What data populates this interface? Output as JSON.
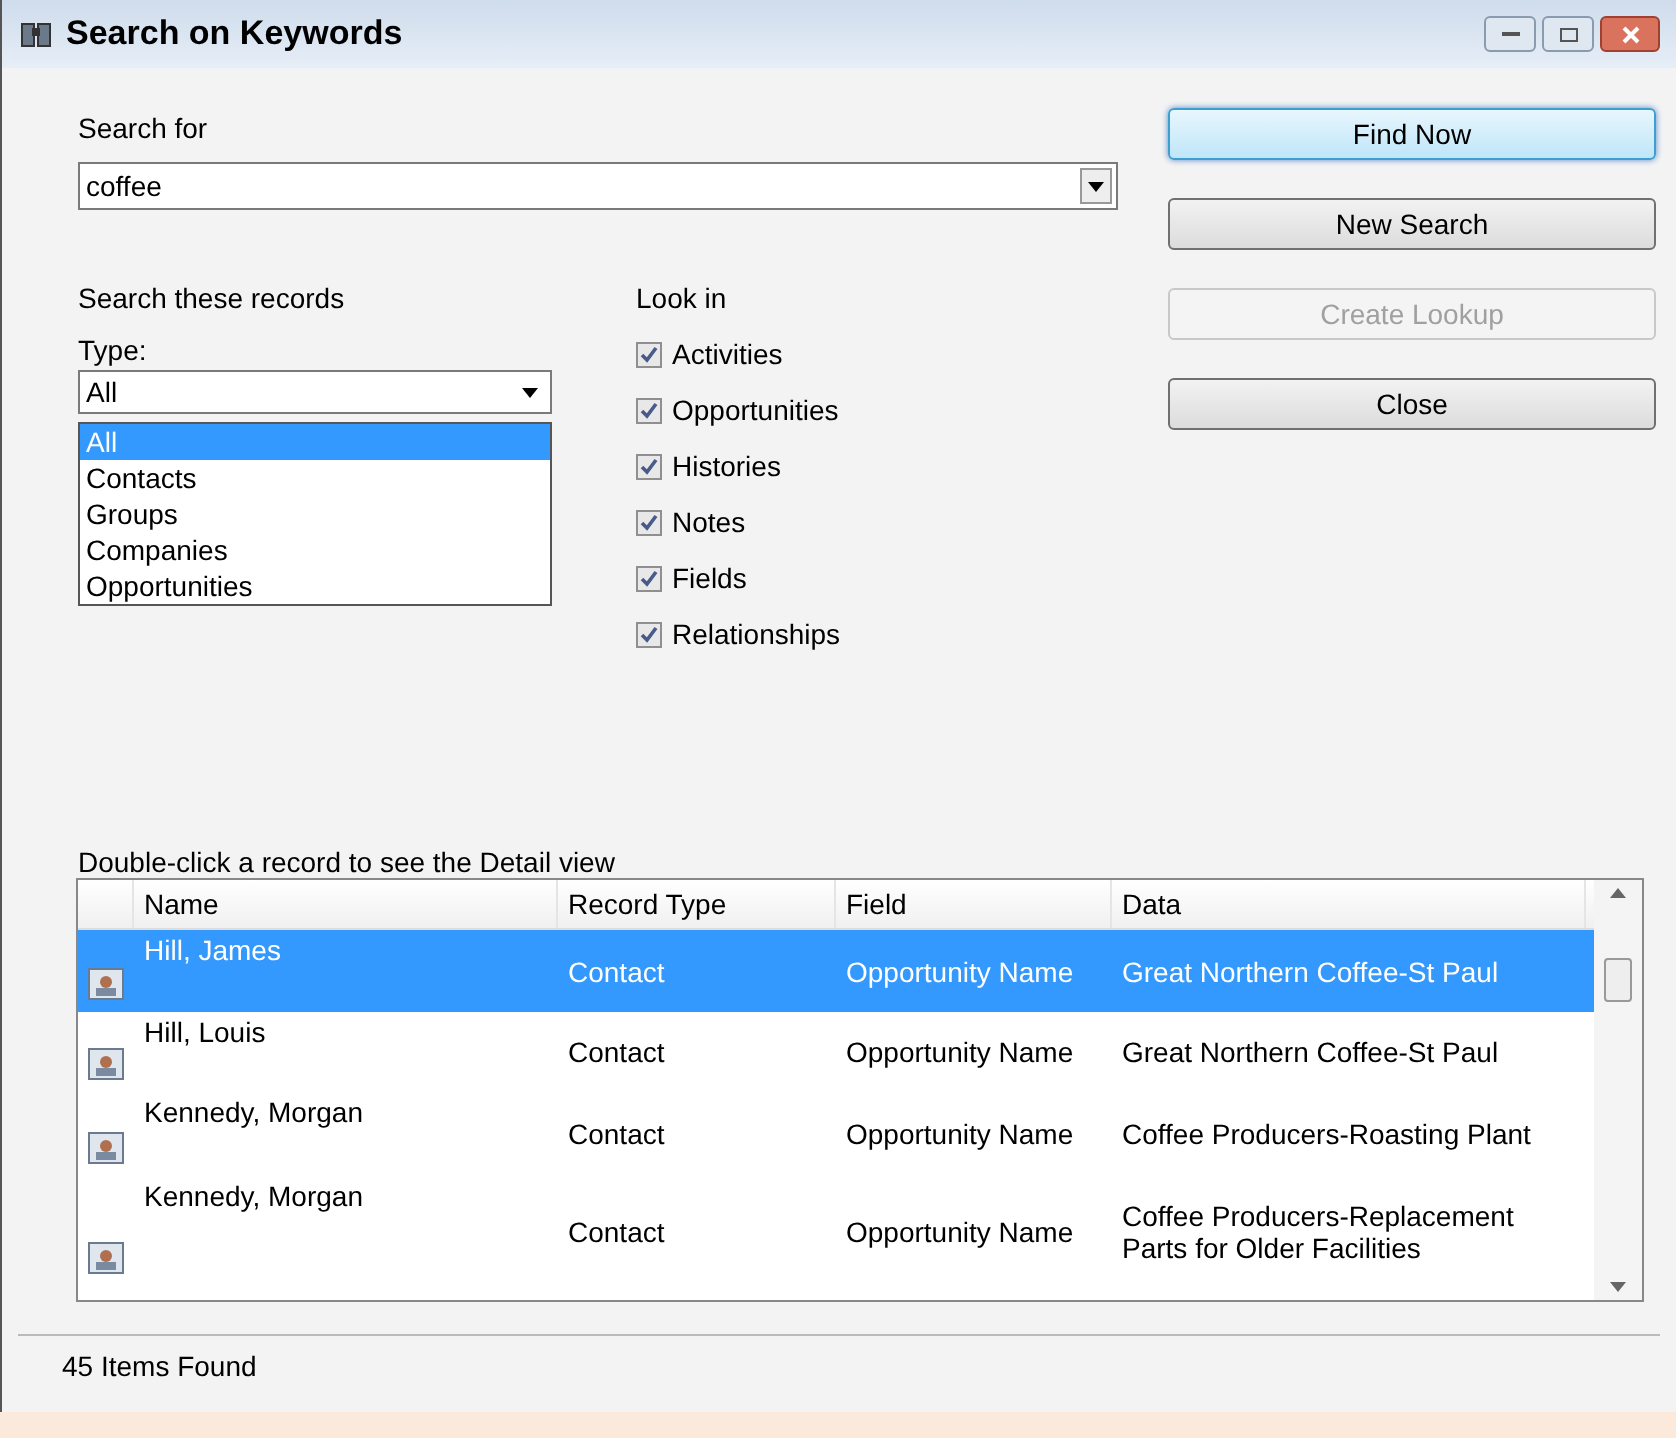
{
  "window": {
    "title": "Search on Keywords"
  },
  "search_for": {
    "label": "Search for",
    "value": "coffee"
  },
  "buttons": [
    {
      "label": "Find Now",
      "disabled": false,
      "focused": true
    },
    {
      "label": "New Search",
      "disabled": false,
      "focused": false
    },
    {
      "label": "Create Lookup",
      "disabled": true,
      "focused": false
    },
    {
      "label": "Close",
      "disabled": false,
      "focused": false
    }
  ],
  "records": {
    "heading": "Search these records",
    "type_label": "Type:",
    "type_value": "All",
    "options": [
      {
        "label": "All",
        "selected": true
      },
      {
        "label": "Contacts",
        "selected": false
      },
      {
        "label": "Groups",
        "selected": false
      },
      {
        "label": "Companies",
        "selected": false
      },
      {
        "label": "Opportunities",
        "selected": false
      }
    ]
  },
  "look_in": {
    "heading": "Look in",
    "items": [
      {
        "label": "Activities",
        "checked": true
      },
      {
        "label": "Opportunities",
        "checked": true
      },
      {
        "label": "Histories",
        "checked": true
      },
      {
        "label": "Notes",
        "checked": true
      },
      {
        "label": "Fields",
        "checked": true
      },
      {
        "label": "Relationships",
        "checked": true
      }
    ]
  },
  "results": {
    "hint": "Double-click a record to see the Detail view",
    "columns": [
      "Name",
      "Record Type",
      "Field",
      "Data"
    ],
    "rows": [
      {
        "name": "Hill, James",
        "record_type": "Contact",
        "field": "Opportunity Name",
        "data": "Great Northern Coffee-St Paul",
        "selected": true
      },
      {
        "name": "Hill, Louis",
        "record_type": "Contact",
        "field": "Opportunity Name",
        "data": "Great Northern Coffee-St Paul",
        "selected": false
      },
      {
        "name": "Kennedy, Morgan",
        "record_type": "Contact",
        "field": "Opportunity Name",
        "data": "Coffee Producers-Roasting Plant",
        "selected": false
      },
      {
        "name": "Kennedy, Morgan",
        "record_type": "Contact",
        "field": "Opportunity Name",
        "data": "Coffee Producers-Replacement Parts for Older Facilities",
        "selected": false
      }
    ]
  },
  "status_bar": "45 Items Found"
}
